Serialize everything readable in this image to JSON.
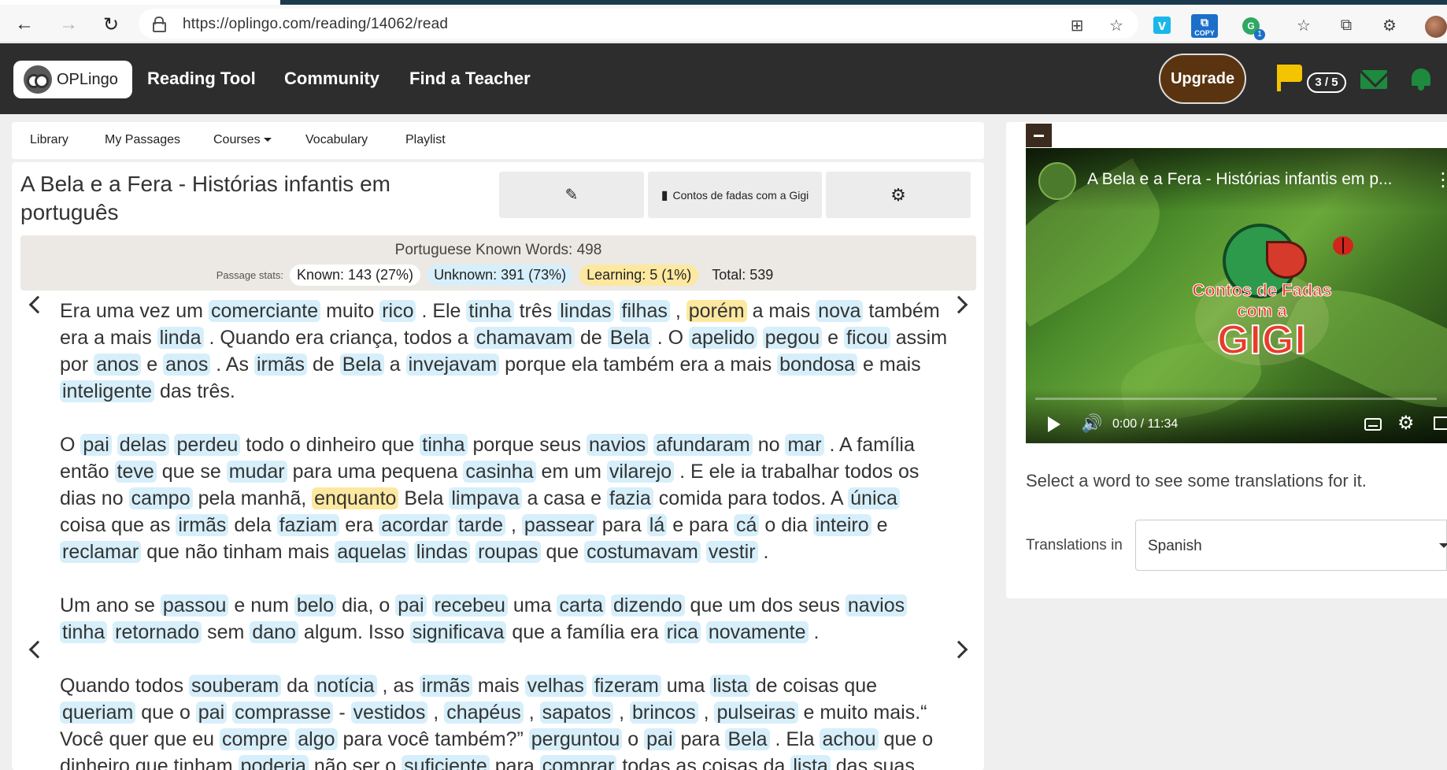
{
  "browser": {
    "url": "https://oplingo.com/reading/14062/read",
    "copy_extension_label": "COPY",
    "grammar_badge": "1"
  },
  "app": {
    "logo_text": "OPLingo",
    "nav": [
      "Reading Tool",
      "Community",
      "Find a Teacher"
    ],
    "upgrade_label": "Upgrade",
    "flag_count": "3 / 5",
    "accent_colors": {
      "header": "#2d2d2d",
      "upgrade": "#5a3410",
      "flag": "#f5c400",
      "mail": "#1d8a3e"
    }
  },
  "subnav": {
    "items": [
      "Library",
      "My Passages",
      "Courses",
      "Vocabulary",
      "Playlist"
    ]
  },
  "reader": {
    "title": "A Bela e a Fera - Histórias infantis em português",
    "collection_label": "Contos de fadas com a Gigi",
    "known_words": "Portuguese Known Words: 498",
    "stats_label": "Passage stats:",
    "stats": {
      "known": "Known: 143 (27%)",
      "unknown": "Unknown: 391 (73%)",
      "learning": "Learning: 5 (1%)",
      "total": "Total: 539"
    },
    "highlight_colors": {
      "unknown": "#d6effa",
      "learning": "#fde8a0"
    },
    "paragraphs": [
      [
        [
          "Era uma vez um",
          ""
        ],
        [
          "comerciante",
          "u"
        ],
        [
          "muito",
          ""
        ],
        [
          "rico",
          "u"
        ],
        [
          ". Ele",
          ""
        ],
        [
          "tinha",
          "u"
        ],
        [
          "três",
          ""
        ],
        [
          "lindas",
          "u"
        ],
        [
          "filhas",
          "u"
        ],
        [
          ",",
          ""
        ],
        [
          "porém",
          "l"
        ],
        [
          "a mais",
          ""
        ],
        [
          "nova",
          "u"
        ],
        [
          "também era a mais",
          ""
        ],
        [
          "linda",
          "u"
        ],
        [
          ". Quando era criança, todos a",
          ""
        ],
        [
          "chamavam",
          "u"
        ],
        [
          "de",
          ""
        ],
        [
          "Bela",
          "u"
        ],
        [
          ". O",
          ""
        ],
        [
          "apelido",
          "u"
        ],
        [
          "pegou",
          "u"
        ],
        [
          "e",
          ""
        ],
        [
          "ficou",
          "u"
        ],
        [
          "assim por",
          ""
        ],
        [
          "anos",
          "u"
        ],
        [
          "e",
          ""
        ],
        [
          "anos",
          "u"
        ],
        [
          ". As",
          ""
        ],
        [
          "irmãs",
          "u"
        ],
        [
          "de",
          ""
        ],
        [
          "Bela",
          "u"
        ],
        [
          "a",
          ""
        ],
        [
          "invejavam",
          "u"
        ],
        [
          "porque ela também era a mais",
          ""
        ],
        [
          "bondosa",
          "u"
        ],
        [
          "e mais",
          ""
        ],
        [
          "inteligente",
          "u"
        ],
        [
          "das três.",
          ""
        ]
      ],
      [
        [
          "O",
          ""
        ],
        [
          "pai",
          "u"
        ],
        [
          "delas",
          "u"
        ],
        [
          "perdeu",
          "u"
        ],
        [
          "todo o dinheiro que",
          ""
        ],
        [
          "tinha",
          "u"
        ],
        [
          "porque seus",
          ""
        ],
        [
          "navios",
          "u"
        ],
        [
          "afundaram",
          "u"
        ],
        [
          "no",
          ""
        ],
        [
          "mar",
          "u"
        ],
        [
          ". A família então",
          ""
        ],
        [
          "teve",
          "u"
        ],
        [
          "que se",
          ""
        ],
        [
          "mudar",
          "u"
        ],
        [
          "para uma pequena",
          ""
        ],
        [
          "casinha",
          "u"
        ],
        [
          "em um",
          ""
        ],
        [
          "vilarejo",
          "u"
        ],
        [
          ". E ele ia trabalhar todos os dias no",
          ""
        ],
        [
          "campo",
          "u"
        ],
        [
          "pela manhã,",
          ""
        ],
        [
          "enquanto",
          "l"
        ],
        [
          "Bela",
          ""
        ],
        [
          "limpava",
          "u"
        ],
        [
          "a casa e",
          ""
        ],
        [
          "fazia",
          "u"
        ],
        [
          "comida para todos. A",
          ""
        ],
        [
          "única",
          "u"
        ],
        [
          "coisa que as",
          ""
        ],
        [
          "irmãs",
          "u"
        ],
        [
          "dela",
          ""
        ],
        [
          "faziam",
          "u"
        ],
        [
          "era",
          ""
        ],
        [
          "acordar",
          "u"
        ],
        [
          "tarde",
          "u"
        ],
        [
          ",",
          ""
        ],
        [
          "passear",
          "u"
        ],
        [
          "para",
          ""
        ],
        [
          "lá",
          "u"
        ],
        [
          "e para",
          ""
        ],
        [
          "cá",
          "u"
        ],
        [
          "o dia",
          ""
        ],
        [
          "inteiro",
          "u"
        ],
        [
          "e",
          ""
        ],
        [
          "reclamar",
          "u"
        ],
        [
          "que não tinham mais",
          ""
        ],
        [
          "aquelas",
          "u"
        ],
        [
          "lindas",
          "u"
        ],
        [
          "roupas",
          "u"
        ],
        [
          "que",
          ""
        ],
        [
          "costumavam",
          "u"
        ],
        [
          "vestir",
          "u"
        ],
        [
          ".",
          ""
        ]
      ],
      [
        [
          "Um ano se",
          ""
        ],
        [
          "passou",
          "u"
        ],
        [
          "e num",
          ""
        ],
        [
          "belo",
          "u"
        ],
        [
          "dia, o",
          ""
        ],
        [
          "pai",
          "u"
        ],
        [
          "recebeu",
          "u"
        ],
        [
          "uma",
          ""
        ],
        [
          "carta",
          "u"
        ],
        [
          "dizendo",
          "u"
        ],
        [
          "que um dos seus",
          ""
        ],
        [
          "navios",
          "u"
        ],
        [
          "tinha",
          "u"
        ],
        [
          "retornado",
          "u"
        ],
        [
          "sem",
          ""
        ],
        [
          "dano",
          "u"
        ],
        [
          "algum. Isso",
          ""
        ],
        [
          "significava",
          "u"
        ],
        [
          "que a família era",
          ""
        ],
        [
          "rica",
          "u"
        ],
        [
          "novamente",
          "u"
        ],
        [
          ".",
          ""
        ]
      ],
      [
        [
          "Quando todos",
          ""
        ],
        [
          "souberam",
          "u"
        ],
        [
          "da",
          ""
        ],
        [
          "notícia",
          "u"
        ],
        [
          ", as",
          ""
        ],
        [
          "irmãs",
          "u"
        ],
        [
          "mais",
          ""
        ],
        [
          "velhas",
          "u"
        ],
        [
          "fizeram",
          "u"
        ],
        [
          "uma",
          ""
        ],
        [
          "lista",
          "u"
        ],
        [
          "de coisas que",
          ""
        ],
        [
          "queriam",
          "u"
        ],
        [
          "que o",
          ""
        ],
        [
          "pai",
          "u"
        ],
        [
          "comprasse",
          "u"
        ],
        [
          "- ",
          ""
        ],
        [
          "vestidos",
          "u"
        ],
        [
          ",",
          ""
        ],
        [
          "chapéus",
          "u"
        ],
        [
          ",",
          ""
        ],
        [
          "sapatos",
          "u"
        ],
        [
          ",",
          ""
        ],
        [
          "brincos",
          "u"
        ],
        [
          ",",
          ""
        ],
        [
          "pulseiras",
          "u"
        ],
        [
          "e muito mais.“ Você quer que eu",
          ""
        ],
        [
          "compre",
          "u"
        ],
        [
          "algo",
          "u"
        ],
        [
          "para você também?”",
          ""
        ],
        [
          "perguntou",
          "u"
        ],
        [
          "o",
          ""
        ],
        [
          "pai",
          "u"
        ],
        [
          "para",
          ""
        ],
        [
          "Bela",
          "u"
        ],
        [
          ". Ela",
          ""
        ],
        [
          "achou",
          "u"
        ],
        [
          "que o dinheiro que tinham",
          ""
        ],
        [
          "poderia",
          "u"
        ],
        [
          "não ser o",
          ""
        ],
        [
          "suficiente",
          "u"
        ],
        [
          "para",
          ""
        ],
        [
          "comprar",
          "u"
        ],
        [
          "todas as coisas da",
          ""
        ],
        [
          "lista",
          "u"
        ],
        [
          "das suas",
          ""
        ]
      ]
    ]
  },
  "video": {
    "title": "A Bela e a Fera - Histórias infantis em p...",
    "logo_line1": "Contos de Fadas com a",
    "logo_line2": "GIGI",
    "time": "0:00 / 11:34",
    "progress": 0
  },
  "translation": {
    "hint": "Select a word to see some translations for it.",
    "label": "Translations in",
    "language": "Spanish"
  }
}
